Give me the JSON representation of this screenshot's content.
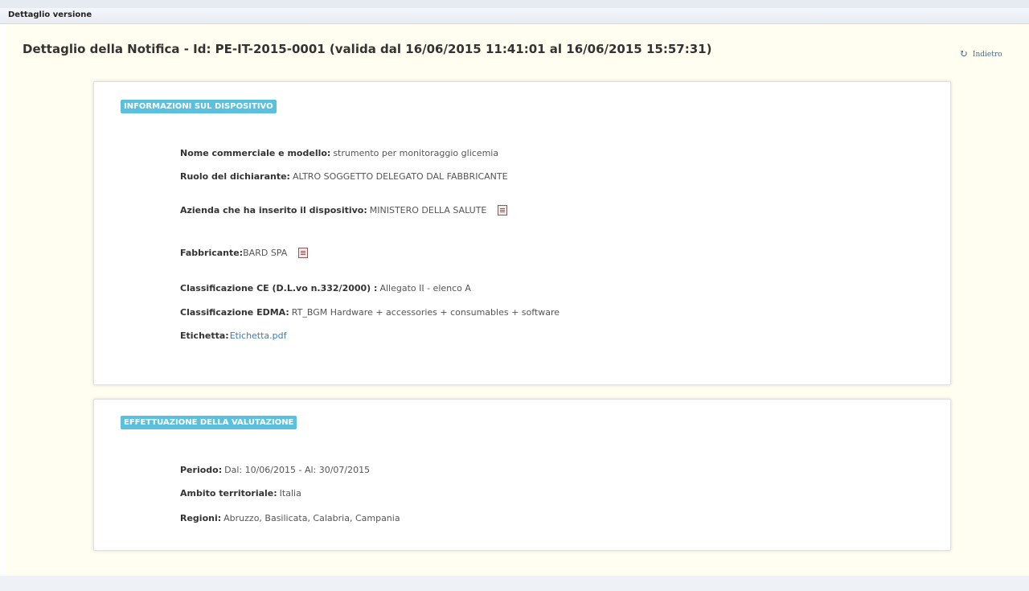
{
  "header": {
    "title": "Dettaglio versione"
  },
  "page": {
    "title": "Dettaglio della Notifica - Id: PE-IT-2015-0001 (valida dal 16/06/2015 11:41:01 al 16/06/2015 15:57:31)",
    "back_label": "Indietro",
    "back_icon": "refresh-icon"
  },
  "device_section": {
    "badge": "INFORMAZIONI SUL DISPOSITIVO",
    "fields": {
      "nome": {
        "label": "Nome commerciale e modello:",
        "value": "strumento per monitoraggio glicemia"
      },
      "ruolo": {
        "label": "Ruolo del dichiarante:",
        "value": "ALTRO SOGGETTO DELEGATO DAL FABBRICANTE"
      },
      "azienda": {
        "label": "Azienda che ha inserito il dispositivo:",
        "value": "MINISTERO DELLA SALUTE"
      },
      "fabbricante": {
        "label": "Fabbricante:",
        "value": "BARD SPA"
      },
      "ce": {
        "label": "Classificazione CE (D.L.vo n.332/2000) :",
        "value": "Allegato II - elenco A"
      },
      "edma": {
        "label": "Classificazione EDMA:",
        "value": "RT_BGM Hardware + accessories + consumables + software"
      },
      "etichetta": {
        "label": "Etichetta:",
        "value": "Etichetta.pdf"
      }
    }
  },
  "evaluation_section": {
    "badge": "EFFETTUAZIONE DELLA VALUTAZIONE",
    "fields": {
      "periodo": {
        "label": "Periodo:",
        "value": "Dal: 10/06/2015 - Al: 30/07/2015"
      },
      "ambito": {
        "label": "Ambito territoriale:",
        "value": "Italia"
      },
      "regioni": {
        "label": "Regioni:",
        "value": "Abruzzo, Basilicata, Calabria, Campania"
      }
    }
  },
  "colors": {
    "panel_bg": "#fffef0",
    "badge_bg": "#5bc0de",
    "link": "#3c7ab8"
  }
}
